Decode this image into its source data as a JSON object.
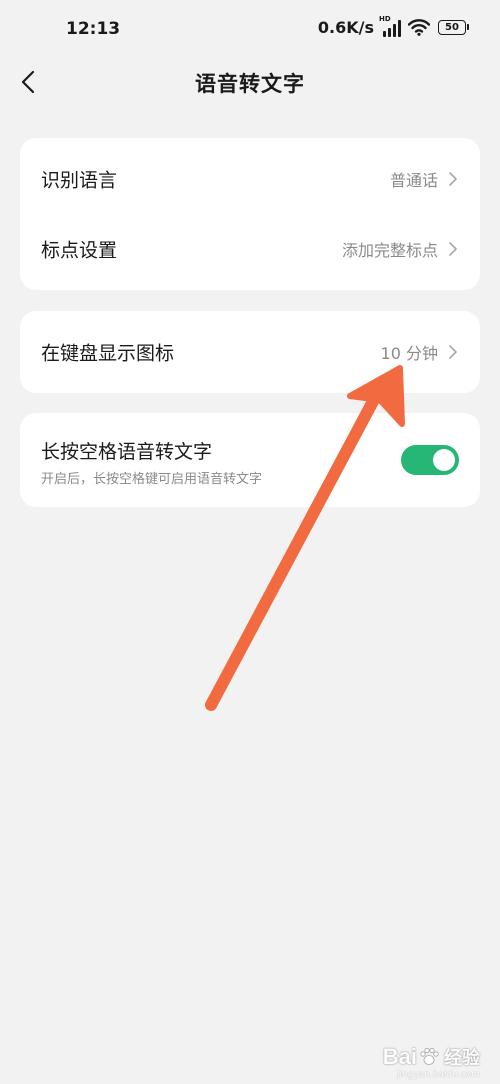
{
  "status_bar": {
    "time": "12:13",
    "net_speed": "0.6K/s",
    "signal_badge": "HD",
    "battery": "50"
  },
  "nav": {
    "title": "语音转文字"
  },
  "settings_group_1": {
    "items": [
      {
        "label": "识别语言",
        "value": "普通话"
      },
      {
        "label": "标点设置",
        "value": "添加完整标点"
      }
    ]
  },
  "settings_group_2": {
    "items": [
      {
        "label": "在键盘显示图标",
        "value": "10 分钟"
      }
    ]
  },
  "settings_group_3": {
    "label": "长按空格语音转文字",
    "description": "开启后，长按空格键可启用语音转文字",
    "toggle_on": true
  },
  "colors": {
    "background": "#f2f2f2",
    "card": "#ffffff",
    "toggle_on": "#26b777",
    "annotation_arrow": "#f26a3f"
  },
  "watermark": {
    "brand": "Bai",
    "brand_suffix": "经验",
    "url": "jingyan.baidu.com"
  }
}
